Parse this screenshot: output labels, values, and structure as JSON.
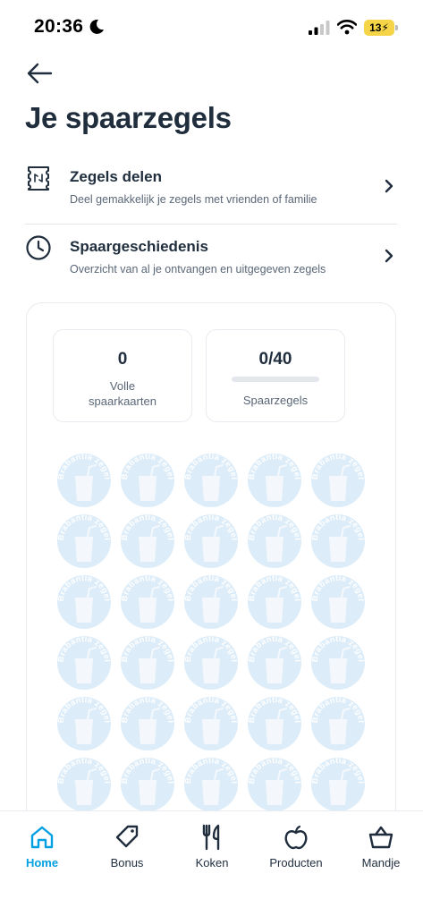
{
  "status_bar": {
    "time": "20:36",
    "battery": "13"
  },
  "header": {
    "title": "Je spaarzegels"
  },
  "menu": [
    {
      "title": "Zegels delen",
      "subtitle": "Deel gemakkelijk je zegels met vrienden of familie",
      "icon": "stamp-share-icon"
    },
    {
      "title": "Spaargeschiedenis",
      "subtitle": "Overzicht van al je ontvangen en uitgegeven zegels",
      "icon": "clock-icon"
    }
  ],
  "stats": {
    "full_cards_value": "0",
    "full_cards_label_line1": "Volle",
    "full_cards_label_line2": "spaarkaarten",
    "stamps_value": "0/40",
    "stamps_label": "Spaarzegels",
    "stamps_progress": 0
  },
  "stamp_text": "Brabantia zegel",
  "colors": {
    "accent": "#00a0e2",
    "text": "#1f2d3d",
    "stamp": "#dcecf8"
  },
  "tabs": [
    {
      "label": "Home",
      "icon": "home-icon",
      "active": true
    },
    {
      "label": "Bonus",
      "icon": "tag-icon",
      "active": false
    },
    {
      "label": "Koken",
      "icon": "fork-knife-icon",
      "active": false
    },
    {
      "label": "Producten",
      "icon": "apple-icon",
      "active": false
    },
    {
      "label": "Mandje",
      "icon": "basket-icon",
      "active": false
    }
  ]
}
